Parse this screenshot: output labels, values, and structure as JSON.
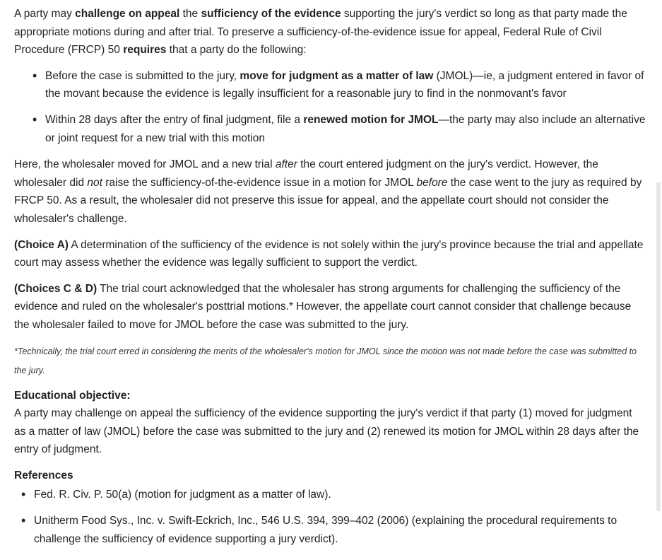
{
  "intro": {
    "t1": "A party may ",
    "b1": "challenge on appeal",
    "t2": " the ",
    "b2": "sufficiency of the evidence",
    "t3": " supporting the jury's verdict so long as that party made the appropriate motions during and after trial.  To preserve a sufficiency-of-the-evidence issue for appeal, Federal Rule of Civil Procedure (FRCP) 50 ",
    "b3": "requires",
    "t4": " that a party do the following:"
  },
  "steps": [
    {
      "t1": "Before the case is submitted to the jury, ",
      "b1": "move for judgment as a matter of law",
      "t2": " (JMOL)—ie, a judgment entered in favor of the movant because the evidence is legally insufficient for a reasonable jury to find in the nonmovant's favor"
    },
    {
      "t1": "Within 28 days after the entry of final judgment, file a ",
      "b1": "renewed motion for JMOL",
      "t2": "—the party may also include an alternative or joint request for a new trial with this motion"
    }
  ],
  "analysis": {
    "t1": "Here, the wholesaler moved for JMOL and a new trial ",
    "i1": "after",
    "t2": " the court entered judgment on the jury's verdict.  However, the wholesaler did ",
    "i2": "not",
    "t3": " raise the sufficiency-of-the-evidence issue in a motion for JMOL ",
    "i3": "before",
    "t4": " the case went to the jury as required by FRCP 50.  As a result, the wholesaler did not preserve this issue for appeal, and the appellate court should not consider the wholesaler's challenge."
  },
  "choice_a": {
    "label": "(Choice A)",
    "text": "  A determination of the sufficiency of the evidence is not solely within the jury's province because the trial and appellate court may assess whether the evidence was legally sufficient to support the verdict."
  },
  "choice_cd": {
    "label": "(Choices C & D)",
    "text": "  The trial court acknowledged that the wholesaler has strong arguments for challenging the sufficiency of the evidence and ruled on the wholesaler's posttrial motions.*  However, the appellate court cannot consider that challenge because the wholesaler failed to move for JMOL before the case was submitted to the jury."
  },
  "footnote": "*Technically, the trial court erred in considering the merits of the wholesaler's motion for JMOL since the motion was not made before the case was submitted to the jury.",
  "objective": {
    "heading": "Educational objective:",
    "text": "A party may challenge on appeal the sufficiency of the evidence supporting the jury's verdict if that party (1) moved for judgment as a matter of law (JMOL) before the case was submitted to the jury and (2) renewed its motion for JMOL within 28 days after the entry of judgment."
  },
  "references": {
    "heading": "References",
    "items": [
      "Fed. R. Civ. P. 50(a) (motion for judgment as a matter of law).",
      "Unitherm Food Sys., Inc. v. Swift-Eckrich, Inc., 546 U.S. 394, 399–402 (2006) (explaining the procedural requirements to challenge the sufficiency of evidence supporting a jury verdict)."
    ]
  }
}
